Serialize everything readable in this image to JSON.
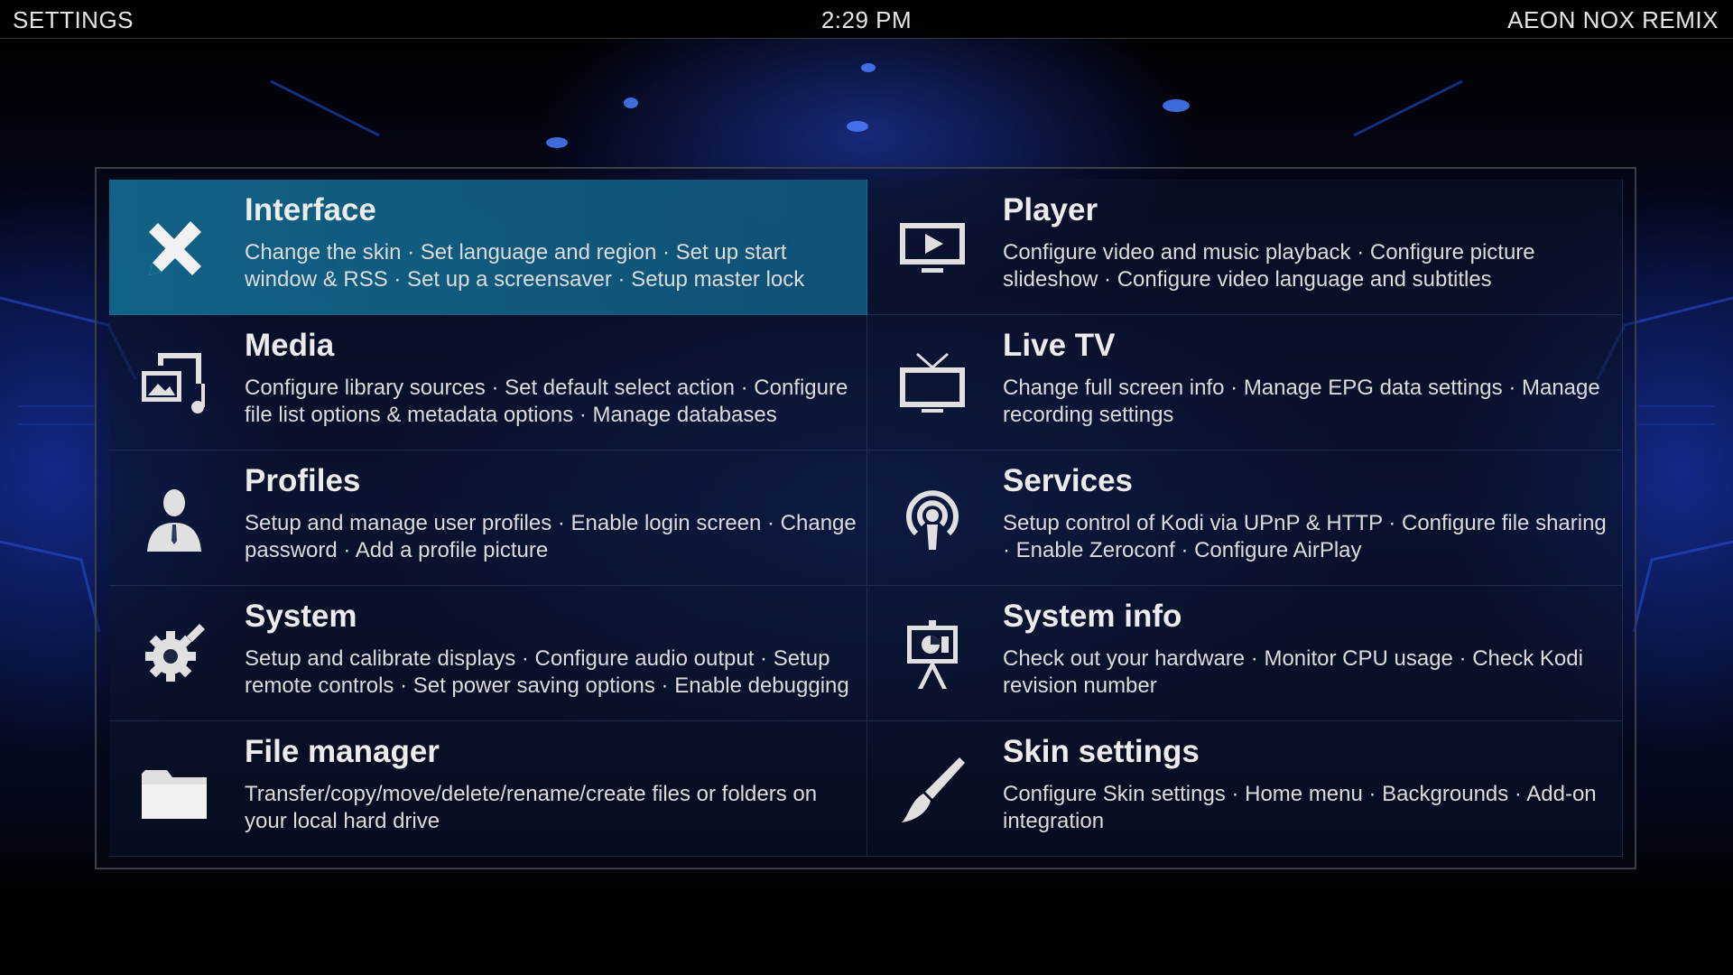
{
  "header": {
    "section_title": "SETTINGS",
    "clock": "2:29 PM",
    "skin_name": "AEON NOX REMIX"
  },
  "menu": {
    "selected_index": 0,
    "items": [
      {
        "title": "Interface",
        "icon": "pencil-ruler-icon",
        "description": "Change the skin · Set language and region · Set up start window & RSS · Set up a screensaver · Setup master lock"
      },
      {
        "title": "Player",
        "icon": "monitor-play-icon",
        "description": "Configure video and music playback · Configure picture slideshow · Configure video language and subtitles"
      },
      {
        "title": "Media",
        "icon": "media-library-icon",
        "description": "Configure library sources · Set default select action · Configure file list options & metadata options · Manage databases"
      },
      {
        "title": "Live TV",
        "icon": "tv-antenna-icon",
        "description": "Change full screen info · Manage EPG data settings · Manage recording settings"
      },
      {
        "title": "Profiles",
        "icon": "user-profile-icon",
        "description": "Setup and manage user profiles · Enable login screen · Change password · Add a profile picture"
      },
      {
        "title": "Services",
        "icon": "broadcast-icon",
        "description": "Setup control of Kodi via UPnP & HTTP · Configure file sharing · Enable Zeroconf · Configure AirPlay"
      },
      {
        "title": "System",
        "icon": "gear-wrench-icon",
        "description": "Setup and calibrate displays · Configure audio output · Setup remote controls · Set power saving options · Enable debugging"
      },
      {
        "title": "System info",
        "icon": "presentation-board-icon",
        "description": "Check out your hardware · Monitor CPU usage · Check Kodi revision number"
      },
      {
        "title": "File manager",
        "icon": "folder-icon",
        "description": "Transfer/copy/move/delete/rename/create files or folders on your local hard drive"
      },
      {
        "title": "Skin settings",
        "icon": "paintbrush-icon",
        "description": "Configure Skin settings · Home menu · Backgrounds · Add-on integration"
      }
    ]
  },
  "colors": {
    "selected_highlight": "#12668a",
    "text": "#ececec",
    "icon": "#e0e0e0"
  }
}
